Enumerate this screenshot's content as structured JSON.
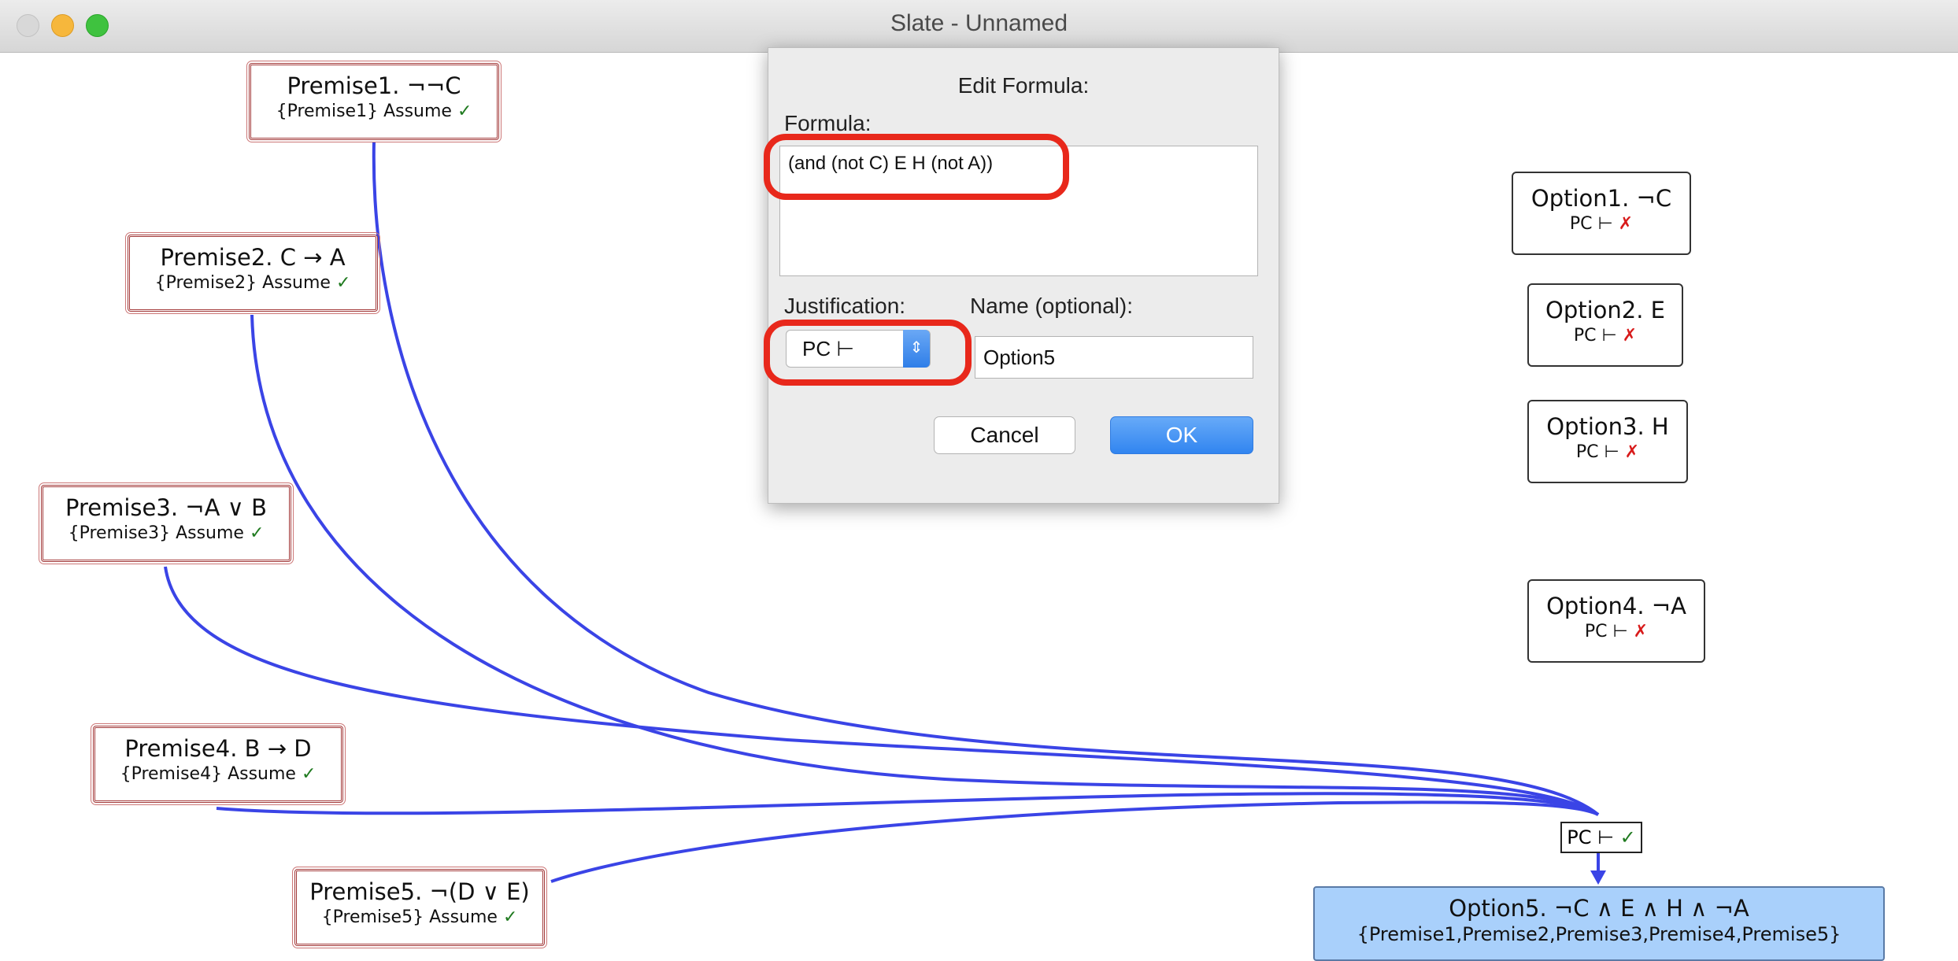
{
  "window": {
    "title": "Slate - Unnamed"
  },
  "premises": [
    {
      "formula": "Premise1. ¬¬C",
      "support": "{Premise1} Assume"
    },
    {
      "formula": "Premise2. C → A",
      "support": "{Premise2} Assume"
    },
    {
      "formula": "Premise3. ¬A ∨ B",
      "support": "{Premise3} Assume"
    },
    {
      "formula": "Premise4. B → D",
      "support": "{Premise4} Assume"
    },
    {
      "formula": "Premise5. ¬(D ∨ E)",
      "support": "{Premise5} Assume"
    }
  ],
  "options": [
    {
      "formula": "Option1. ¬C",
      "justification": "PC ⊢"
    },
    {
      "formula": "Option2. E",
      "justification": "PC ⊢"
    },
    {
      "formula": "Option3. H",
      "justification": "PC ⊢"
    },
    {
      "formula": "Option4. ¬A",
      "justification": "PC ⊢"
    }
  ],
  "marks": {
    "valid": "✓",
    "invalid": "✗"
  },
  "goal": {
    "justification": "PC ⊢",
    "formula": "Option5. ¬C ∧ E ∧ H ∧ ¬A",
    "support": "{Premise1,Premise2,Premise3,Premise4,Premise5}"
  },
  "dialog": {
    "title": "Edit Formula:",
    "formula_label": "Formula:",
    "formula_value": "(and (not C) E H (not A))",
    "justification_label": "Justification:",
    "justification_value": "PC ⊢",
    "name_label": "Name (optional):",
    "name_value": "Option5",
    "cancel_label": "Cancel",
    "ok_label": "OK"
  },
  "colors": {
    "link": "#3a44e6",
    "highlight": "#e8281b",
    "goal_fill": "#a9d0fb",
    "premise_border": "#a33a3a"
  }
}
